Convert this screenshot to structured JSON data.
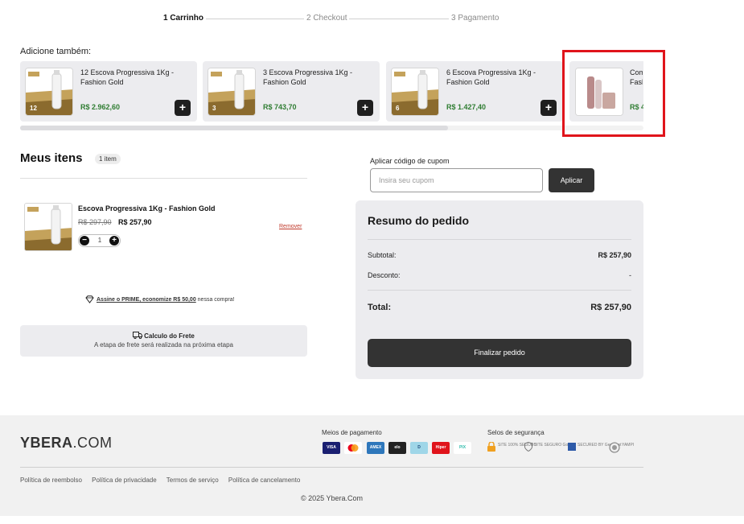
{
  "steps": [
    {
      "label": "1 Carrinho"
    },
    {
      "label": "2 Checkout"
    },
    {
      "label": "3 Pagamento"
    }
  ],
  "upsell": {
    "title": "Adicione também:",
    "add_icon": "+",
    "items": [
      {
        "name": "12 Escova Progressiva 1Kg - Fashion Gold",
        "price": "R$ 2.962,60",
        "badge": "12"
      },
      {
        "name": "3 Escova Progressiva 1Kg - Fashion Gold",
        "price": "R$ 743,70",
        "badge": "3"
      },
      {
        "name": "6 Escova Progressiva 1Kg - Fashion Gold",
        "price": "R$ 1.427,40",
        "badge": "6"
      },
      {
        "name": "Com Fash",
        "price": "R$ 4"
      }
    ]
  },
  "cart": {
    "title": "Meus itens",
    "count_badge": "1 item",
    "item": {
      "name": "Escova Progressiva 1Kg - Fashion Gold",
      "old_price": "R$ 297,90",
      "price": "R$ 257,90",
      "qty": "1",
      "minus": "−",
      "plus": "+",
      "remove": "Remover"
    },
    "prime": {
      "link": "Assine o PRIME, economize R$ 50,00",
      "rest": " nessa compra!"
    },
    "frete": {
      "title": "Calculo do Frete",
      "subtitle": "A etapa de frete será realizada na próxima etapa"
    }
  },
  "coupon": {
    "label": "Aplicar código de cupom",
    "placeholder": "Insira seu cupom",
    "value": "",
    "button": "Aplicar"
  },
  "summary": {
    "title": "Resumo do pedido",
    "subtotal_label": "Subtotal:",
    "subtotal_value": "R$ 257,90",
    "discount_label": "Desconto:",
    "discount_value": "-",
    "total_label": "Total:",
    "total_value": "R$ 257,90",
    "finish_button": "Finalizar pedido"
  },
  "footer": {
    "logo_bold": "YBERA",
    "logo_light": ".COM",
    "payments_title": "Meios de pagamento",
    "payments": [
      {
        "label": "VISA",
        "color": "#1a1f71"
      },
      {
        "label": "",
        "color": "#ffffff"
      },
      {
        "label": "AMEX",
        "color": "#2e77bb"
      },
      {
        "label": "elo",
        "color": "#222222"
      },
      {
        "label": "D",
        "color": "#9fd6e8"
      },
      {
        "label": "Hiper",
        "color": "#e0141b"
      },
      {
        "label": "PIX",
        "color": "#ffffff"
      }
    ],
    "security_title": "Selos de segurança",
    "seals": [
      {
        "label": "SITE 100% SEGURO"
      },
      {
        "label": "SITE SEGURO Google"
      },
      {
        "label": "SECURED BY GeoTrust"
      },
      {
        "label": "YAMPI"
      }
    ],
    "links": [
      "Política de reembolso",
      "Política de privacidade",
      "Termos de serviço",
      "Política de cancelamento"
    ],
    "copyright": "© 2025 Ybera.Com"
  },
  "colors": {
    "accent_dark": "#333333",
    "price_green": "#2f7d32",
    "highlight_red": "#e0141b"
  }
}
